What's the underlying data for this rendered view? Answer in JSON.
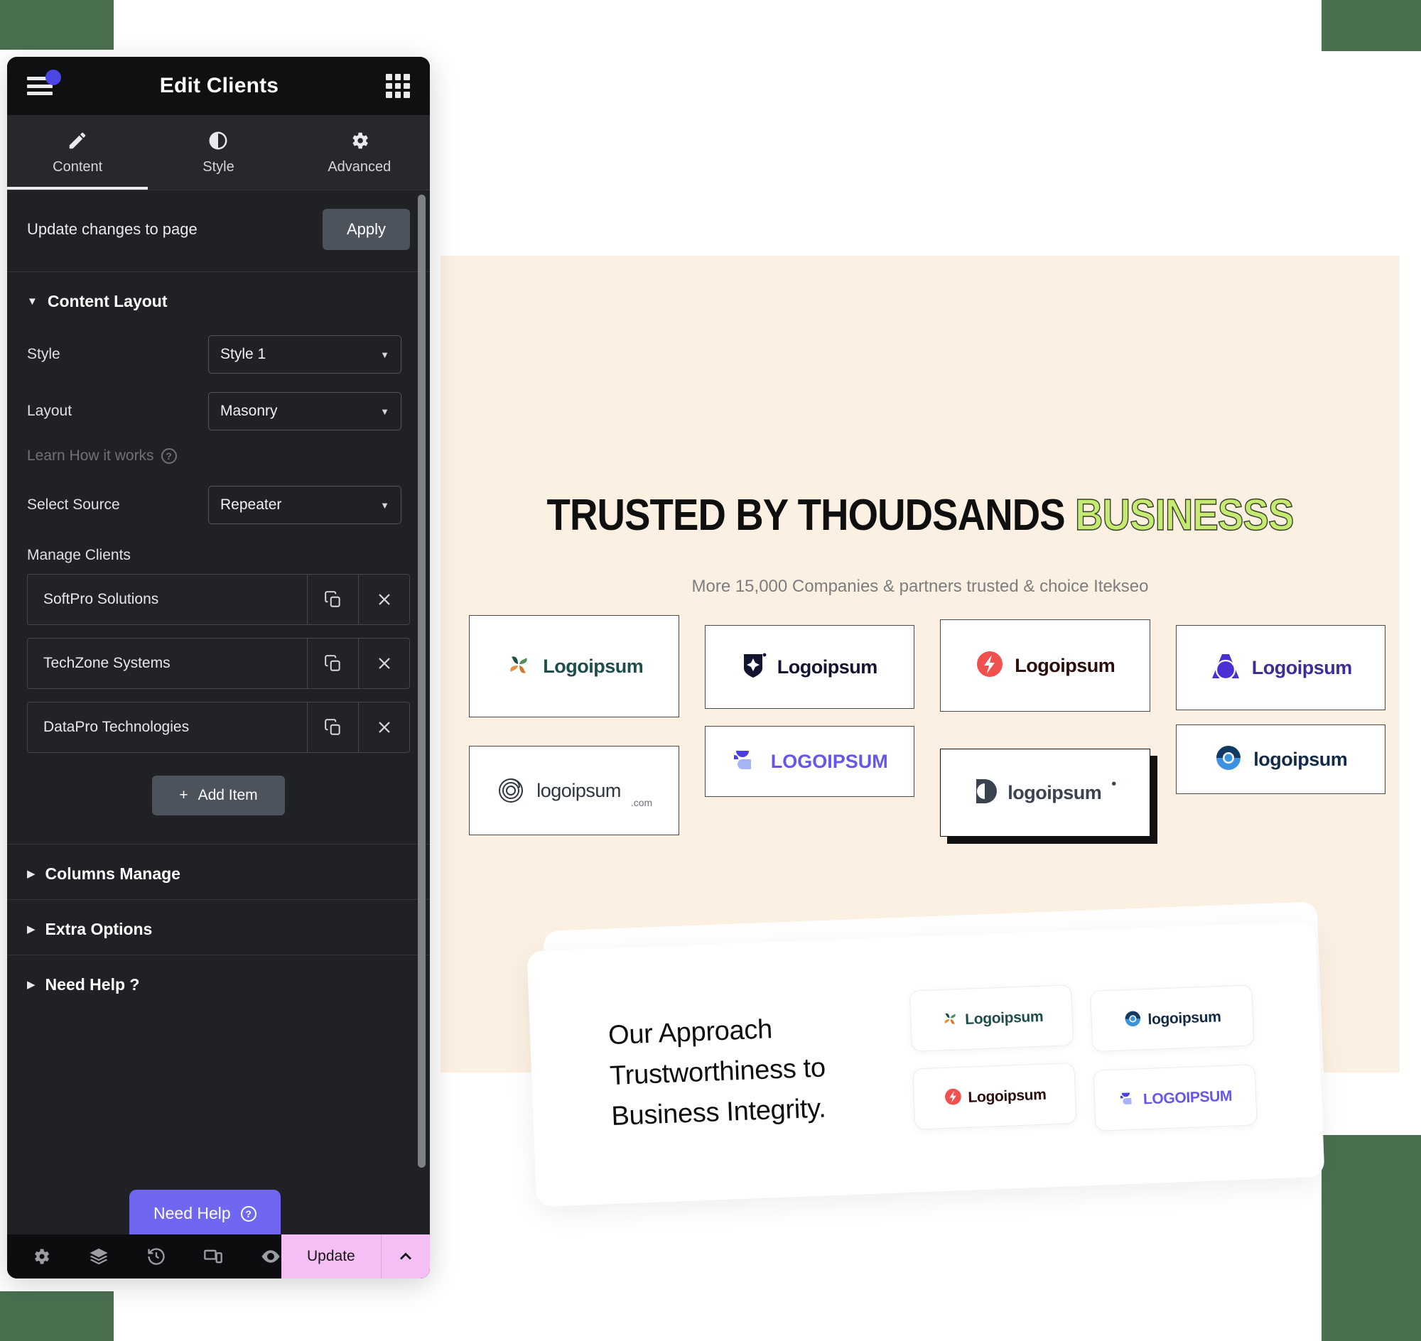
{
  "decor": {
    "green": "#4a7050"
  },
  "panel": {
    "title": "Edit Clients",
    "icons": {
      "menu": "hamburger-icon",
      "apps": "grid-icon",
      "notification": "notification-dot"
    },
    "tabs": [
      {
        "label": "Content",
        "icon": "pencil-icon",
        "active": true
      },
      {
        "label": "Style",
        "icon": "contrast-icon",
        "active": false
      },
      {
        "label": "Advanced",
        "icon": "gear-icon",
        "active": false
      }
    ],
    "apply_row": {
      "label": "Update changes to page",
      "button": "Apply"
    },
    "content_layout": {
      "section_title": "Content Layout",
      "expanded": true,
      "fields": [
        {
          "label": "Style",
          "value": "Style 1"
        },
        {
          "label": "Layout",
          "value": "Masonry"
        }
      ],
      "learn_link": "Learn How it works",
      "source_field": {
        "label": "Select Source",
        "value": "Repeater"
      },
      "manage_label": "Manage Clients",
      "items": [
        {
          "name": "SoftPro Solutions"
        },
        {
          "name": "TechZone Systems"
        },
        {
          "name": "DataPro Technologies"
        }
      ],
      "add_item": "Add Item"
    },
    "sections": [
      {
        "title": "Columns Manage"
      },
      {
        "title": "Extra Options"
      },
      {
        "title": "Need Help ?"
      }
    ],
    "need_help_button": "Need Help",
    "footer": {
      "icons": [
        "gear-icon",
        "layers-icon",
        "history-icon",
        "responsive-icon",
        "eye-icon"
      ],
      "update_label": "Update",
      "caret": "chevron-up-icon"
    }
  },
  "preview": {
    "heading_main": "TRUSTED BY THOUDSANDS",
    "heading_highlight": "BUSINESSS",
    "highlight_color": "#c3ea71",
    "background": "#fcf0e3",
    "subtitle": "More 15,000 Companies & partners trusted & choice Itekseo",
    "logos": [
      {
        "text": "Logoipsum",
        "icon": "pinwheel-logo-icon",
        "color": "#1d4e4b",
        "selected": false
      },
      {
        "text": "Logoipsum",
        "icon": "shield-star-logo-icon",
        "color": "#131432",
        "selected": false
      },
      {
        "text": "Logoipsum",
        "icon": "bolt-circle-logo-icon",
        "color": "#2b0d0b",
        "selected": false
      },
      {
        "text": "Logoipsum",
        "icon": "arch-logo-icon",
        "color": "#3b2f95",
        "selected": false
      },
      {
        "text": "logoipsum",
        "icon": "spiral-logo-icon",
        "color": "#2e3640",
        "selected": false,
        "suffix": ".com"
      },
      {
        "text": "LOGOIPSUM",
        "icon": "bird-logo-icon",
        "color": "#6558e8",
        "selected": false
      },
      {
        "text": "logoipsum",
        "icon": "halfmoon-logo-icon",
        "color": "#3c4350",
        "selected": true,
        "suffix": "•"
      },
      {
        "text": "logoipsum",
        "icon": "eye-circle-logo-icon",
        "color": "#132b4a",
        "selected": false
      }
    ],
    "approach": {
      "line1": "Our Approach",
      "line2": "Trustworthiness to",
      "line3": "Business Integrity.",
      "mini_logos": [
        {
          "text": "Logoipsum",
          "icon": "pinwheel-logo-icon",
          "color": "#1d4e4b"
        },
        {
          "text": "logoipsum",
          "icon": "eye-circle-logo-icon",
          "color": "#132b4a"
        },
        {
          "text": "Logoipsum",
          "icon": "bolt-circle-logo-icon",
          "color": "#2b0d0b"
        },
        {
          "text": "LOGOIPSUM",
          "icon": "bird-logo-icon",
          "color": "#6558e8"
        }
      ]
    }
  }
}
